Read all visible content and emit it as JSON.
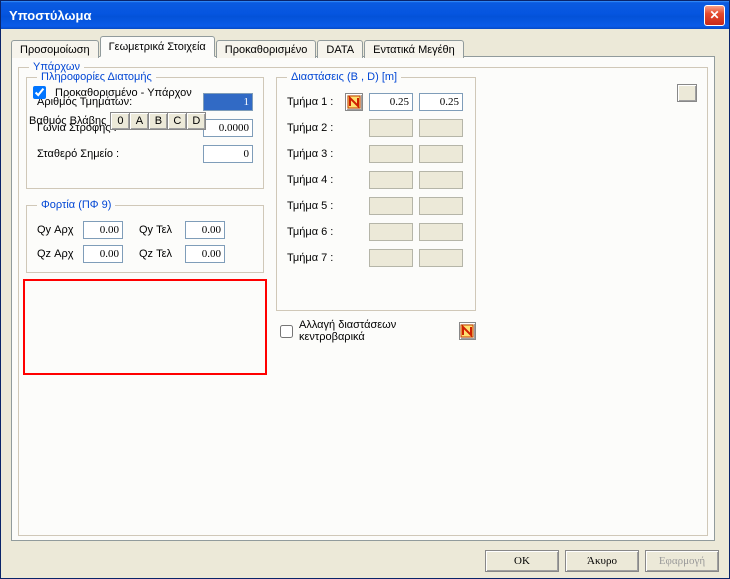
{
  "title": "Υποστύλωμα",
  "tabs": [
    {
      "label": "Προσομοίωση",
      "active": false
    },
    {
      "label": "Γεωμετρικά Στοιχεία",
      "active": true
    },
    {
      "label": "Προκαθορισμένο",
      "active": false
    },
    {
      "label": "DATA",
      "active": false
    },
    {
      "label": "Εντατικά Μεγέθη",
      "active": false
    }
  ],
  "section_info": {
    "legend": "Πληροφορίες Διατομής",
    "segments_label": "Αριθμός Τμημάτων:",
    "segments_value": "1",
    "rotation_label": "Γωνία Στροφής :",
    "rotation_value": "0.0000",
    "fixedpoint_label": "Σταθερό Σημείο :",
    "fixedpoint_value": "0"
  },
  "loads": {
    "legend": "Φορτία (ΠΦ 9)",
    "qy_a_label": "Qy Αρχ",
    "qy_a_value": "0.00",
    "qy_t_label": "Qy Τελ",
    "qy_t_value": "0.00",
    "qz_a_label": "Qz Αρχ",
    "qz_a_value": "0.00",
    "qz_t_label": "Qz Τελ",
    "qz_t_value": "0.00"
  },
  "existing": {
    "legend": "Υπάρχων",
    "chk_label": "Προκαθορισμένο - Υπάρχον",
    "chk_checked": true,
    "grade_label": "Βαθμός Βλάβης",
    "grades": [
      "0",
      "A",
      "B",
      "C",
      "D"
    ]
  },
  "dims": {
    "legend": "Διαστάσεις (B , D) [m]",
    "rows": [
      {
        "label": "Τμήμα 1 :",
        "b": "0.25",
        "d": "0.25",
        "enabled": true,
        "icon": true
      },
      {
        "label": "Τμήμα 2 :",
        "b": "",
        "d": "",
        "enabled": false,
        "icon": false
      },
      {
        "label": "Τμήμα 3 :",
        "b": "",
        "d": "",
        "enabled": false,
        "icon": false
      },
      {
        "label": "Τμήμα 4 :",
        "b": "",
        "d": "",
        "enabled": false,
        "icon": false
      },
      {
        "label": "Τμήμα 5 :",
        "b": "",
        "d": "",
        "enabled": false,
        "icon": false
      },
      {
        "label": "Τμήμα 6 :",
        "b": "",
        "d": "",
        "enabled": false,
        "icon": false
      },
      {
        "label": "Τμήμα 7 :",
        "b": "",
        "d": "",
        "enabled": false,
        "icon": false
      }
    ]
  },
  "centro": {
    "label": "Αλλαγή διαστάσεων κεντροβαρικά",
    "checked": false
  },
  "buttons": {
    "ok": "OK",
    "cancel": "Άκυρο",
    "apply": "Εφαρμογή"
  }
}
